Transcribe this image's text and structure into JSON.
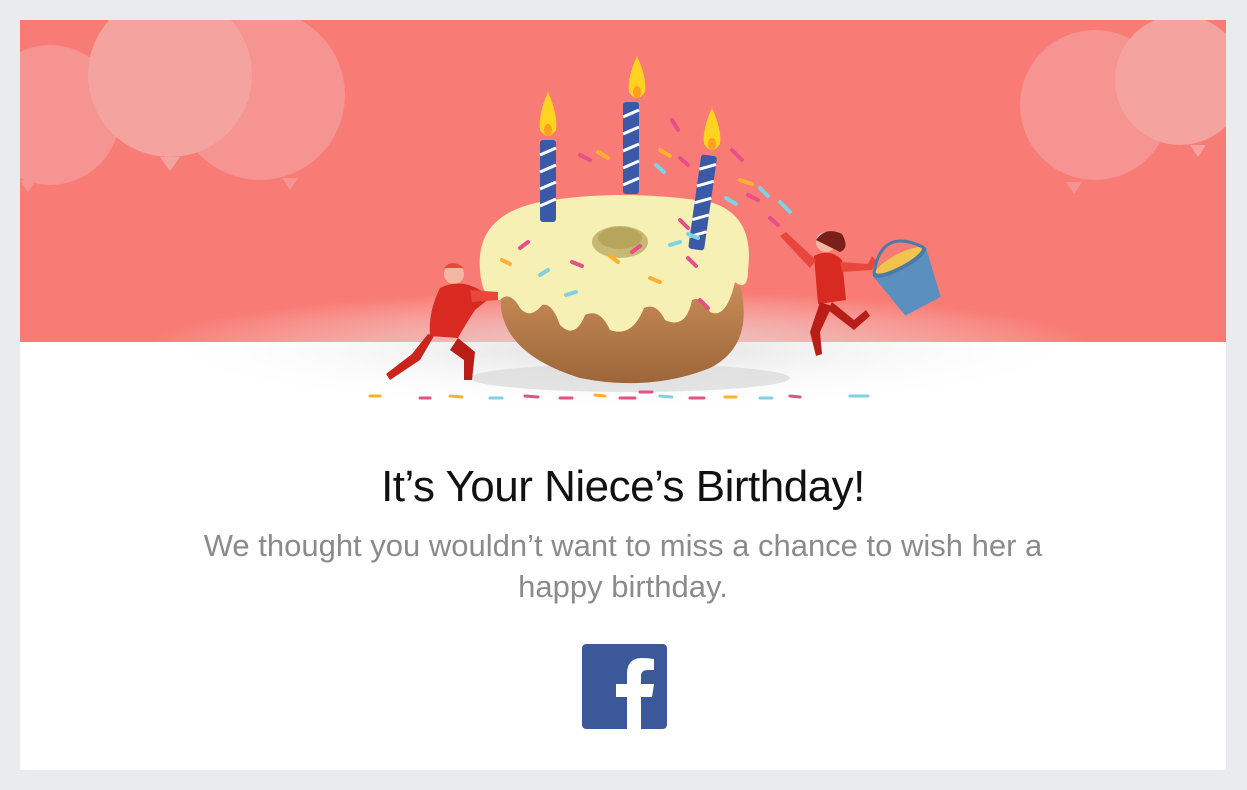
{
  "email": {
    "title": "It’s Your Niece’s Birthday!",
    "message": "We thought you wouldn’t want to miss a chance to wish her a happy birthday."
  },
  "footer": {
    "logo_icon": "facebook-logo-icon"
  },
  "colors": {
    "page_background": "#e9ebee",
    "hero_background": "#f87b75",
    "balloon": "#f6a4a0",
    "cake_icing": "#f7f0b6",
    "cake_dough": "#b97f4c",
    "candle": "#3a5aa8",
    "flame": "#ffd31f",
    "figure": "#d82a20",
    "bucket": "#5b8fbf",
    "facebook_blue": "#3b5998"
  }
}
